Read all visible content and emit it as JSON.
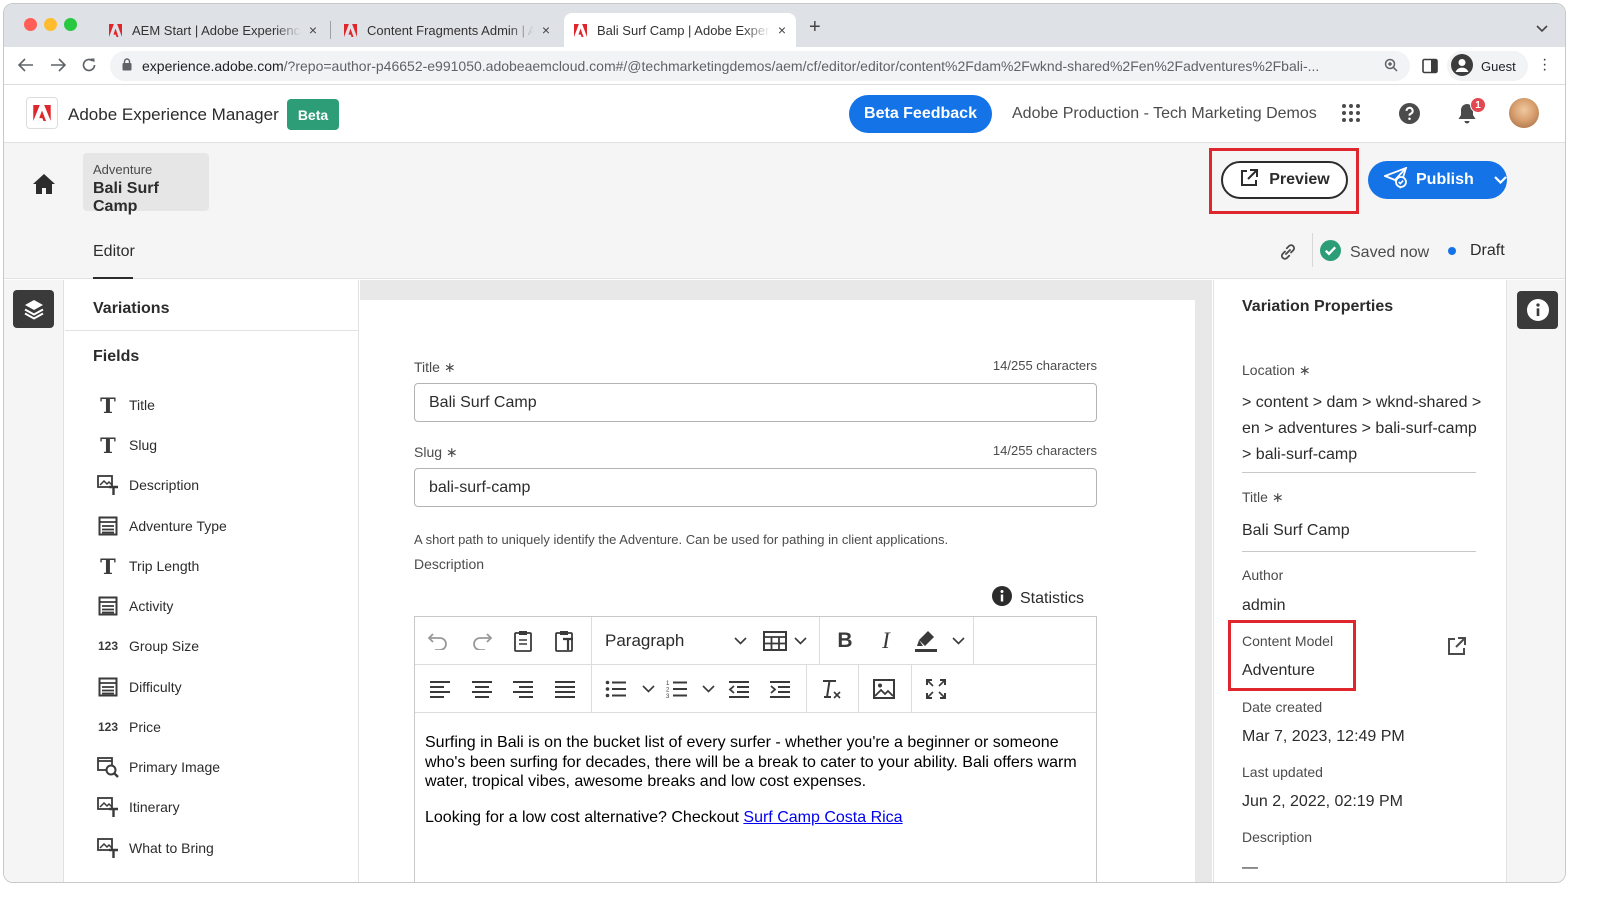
{
  "browser": {
    "tabs": [
      {
        "title": "AEM Start | Adobe Experience Manager",
        "close": "×"
      },
      {
        "title": "Content Fragments Admin | Adobe Experience Manager",
        "close": "×"
      },
      {
        "title": "Bali Surf Camp | Adobe Experience Manager",
        "close": "×"
      }
    ],
    "new_tab": "+",
    "url_host": "experience.adobe.com",
    "url_rest": "/?repo=author-p46652-e991050.adobeaemcloud.com#/@techmarketingdemos/aem/cf/editor/editor/content%2Fdam%2Fwknd-shared%2Fen%2Fadventures%2Fbali-...",
    "profile": "Guest"
  },
  "header": {
    "app_title": "Adobe Experience Manager",
    "beta_badge": "Beta",
    "feedback_label": "Beta Feedback",
    "org_name": "Adobe Production - Tech Marketing Demos",
    "notification_count": "1"
  },
  "toolbar": {
    "breadcrumb_model": "Adventure",
    "breadcrumb_title": "Bali Surf Camp",
    "preview_label": "Preview",
    "publish_label": "Publish",
    "tab_editor": "Editor",
    "saved_status": "Saved now",
    "draft_status": "Draft"
  },
  "left_panel": {
    "variations_label": "Variations",
    "fields_label": "Fields",
    "fields": [
      {
        "label": "Title",
        "icon": "T"
      },
      {
        "label": "Slug",
        "icon": "T"
      },
      {
        "label": "Description",
        "icon": "rich-text"
      },
      {
        "label": "Adventure Type",
        "icon": "enum"
      },
      {
        "label": "Trip Length",
        "icon": "T"
      },
      {
        "label": "Activity",
        "icon": "enum"
      },
      {
        "label": "Group Size",
        "icon": "123"
      },
      {
        "label": "Difficulty",
        "icon": "enum"
      },
      {
        "label": "Price",
        "icon": "123"
      },
      {
        "label": "Primary Image",
        "icon": "image"
      },
      {
        "label": "Itinerary",
        "icon": "rich-text"
      },
      {
        "label": "What to Bring",
        "icon": "rich-text"
      }
    ]
  },
  "form": {
    "title_label": "Title",
    "required_mark": "∗",
    "title_count": "14/255 characters",
    "title_value": "Bali Surf Camp",
    "slug_label": "Slug",
    "slug_count": "14/255 characters",
    "slug_value": "bali-surf-camp",
    "slug_help": "A short path to uniquely identify the Adventure. Can be used for pathing in client applications.",
    "description_label": "Description",
    "statistics_label": "Statistics",
    "paragraph_format": "Paragraph",
    "description_p1": "Surfing in Bali is on the bucket list of every surfer - whether you're a beginner or someone who's been surfing for decades, there will be a break to cater to your ability. Bali offers warm water, tropical vibes, awesome breaks and low cost expenses.",
    "description_p2": "Looking for a low cost alternative? Checkout ",
    "description_link": "Surf Camp Costa Rica"
  },
  "properties": {
    "heading": "Variation Properties",
    "location_label": "Location",
    "location_value": " > content > dam > wknd-shared > en > adventures > bali-surf-camp > bali-surf-camp",
    "title_label": "Title",
    "title_value": "Bali Surf Camp",
    "author_label": "Author",
    "author_value": "admin",
    "model_label": "Content Model",
    "model_value": "Adventure",
    "created_label": "Date created",
    "created_value": "Mar 7, 2023, 12:49 PM",
    "updated_label": "Last updated",
    "updated_value": "Jun 2, 2022, 02:19 PM",
    "description_label": "Description",
    "description_value": "—"
  },
  "colors": {
    "accent_blue": "#1473e6",
    "beta_green": "#2d9d78",
    "highlight_red": "#e0262d",
    "saved_green": "#2d9d78"
  }
}
